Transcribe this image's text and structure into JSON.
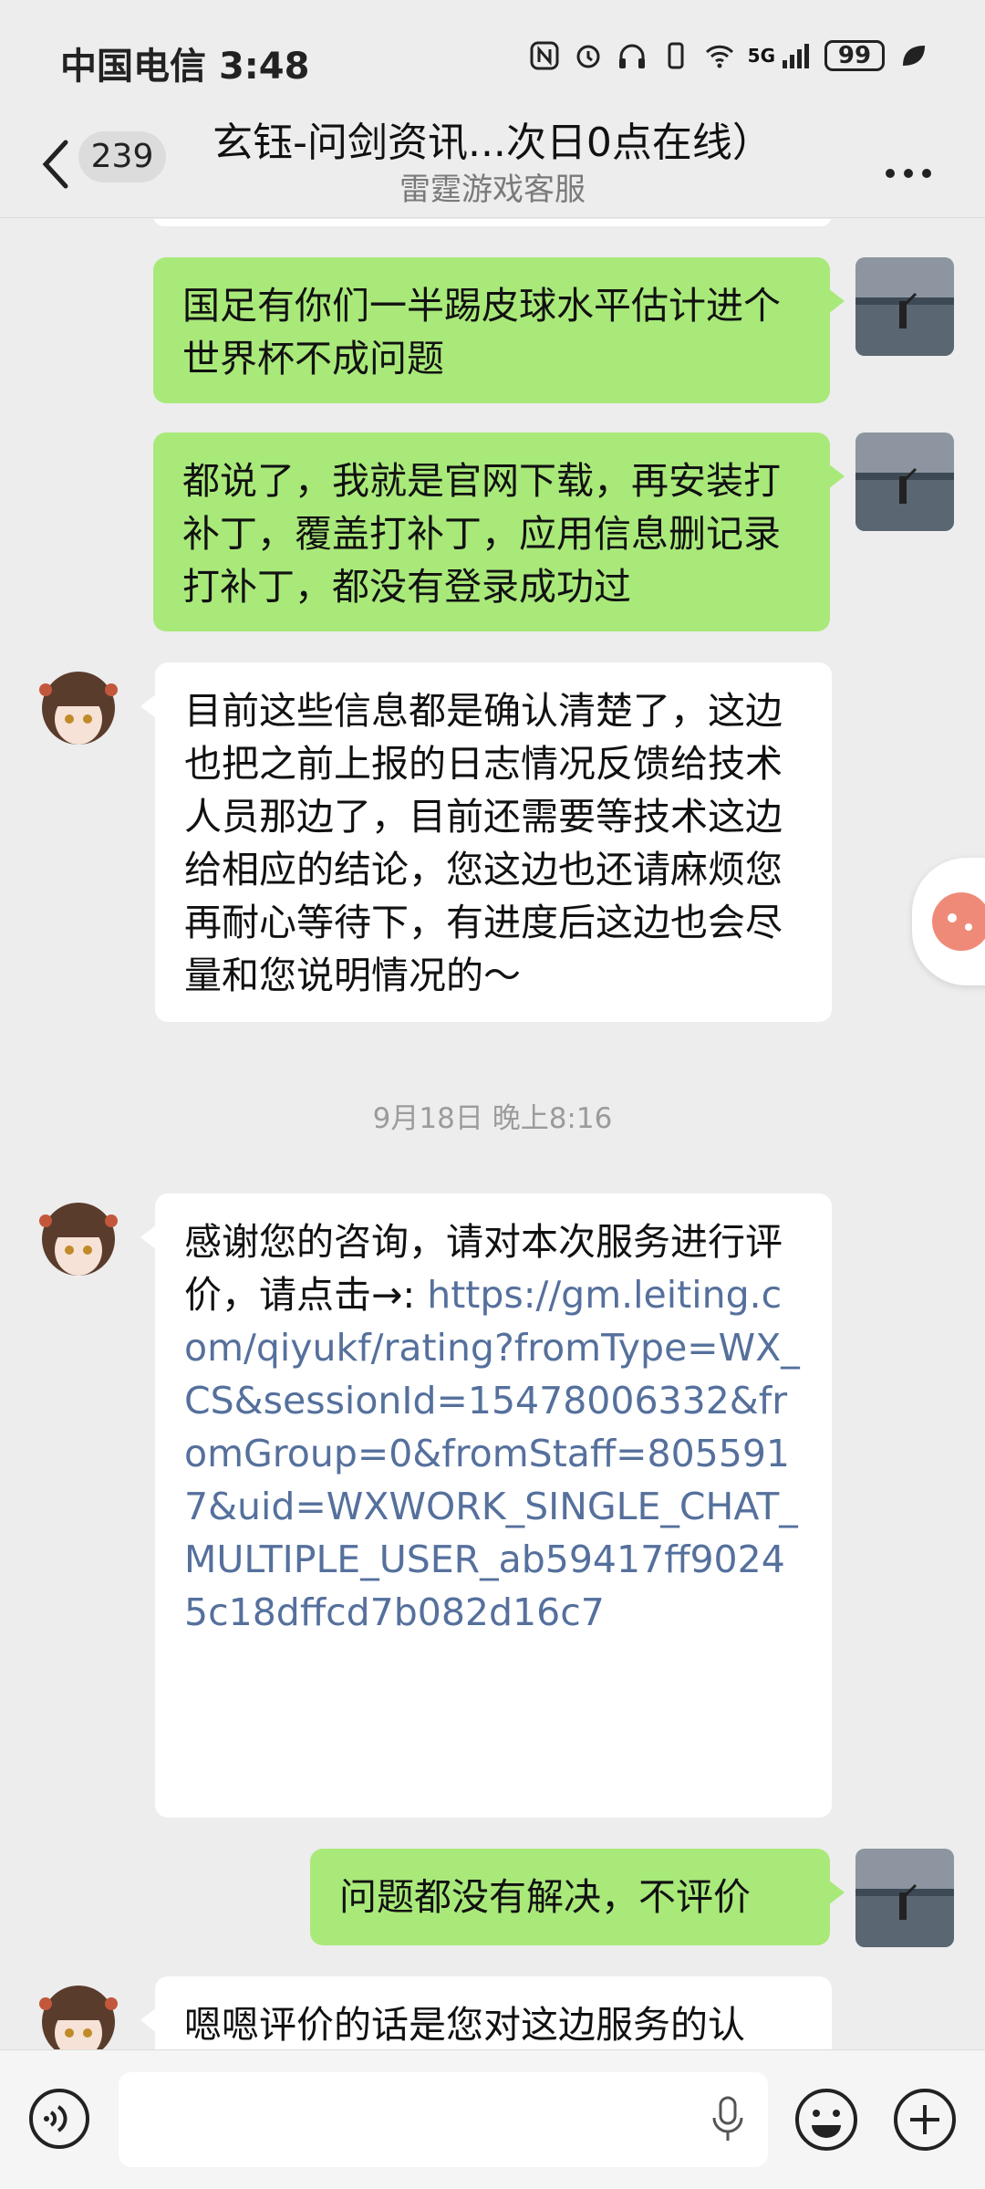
{
  "status_bar": {
    "carrier": "中国电信",
    "time": "3:48",
    "network": "5G",
    "battery": "99"
  },
  "header": {
    "back_count": "239",
    "title": "玄钰-问剑资讯...次日0点在线）",
    "subtitle": "雷霆游戏客服",
    "more_icon": "ellipsis-icon"
  },
  "messages": [
    {
      "direction": "out",
      "text": "国足有你们一半踢皮球水平估计进个世界杯不成问题"
    },
    {
      "direction": "out",
      "text": "都说了，我就是官网下载，再安装打补丁，覆盖打补丁，应用信息删记录打补丁，都没有登录成功过"
    },
    {
      "direction": "in",
      "text": "目前这些信息都是确认清楚了，这边也把之前上报的日志情况反馈给技术人员那边了，目前还需要等技术这边给相应的结论，您这边也还请麻烦您再耐心等待下，有进度后这边也会尽量和您说明情况的～"
    },
    {
      "direction": "in",
      "text_prefix": "感谢您的咨询，请对本次服务进行评价，请点击→: ",
      "link": "https://gm.leiting.com/qiyukf/rating?fromType=WX_CS&sessionId=15478006332&fromGroup=0&fromStaff=8055917&uid=WXWORK_SINGLE_CHAT_MULTIPLE_USER_ab59417ff90245c18dffcd7b082d16c7"
    },
    {
      "direction": "out",
      "text": "问题都没有解决，不评价"
    },
    {
      "direction": "in",
      "text": "嗯嗯评价的话是您对这边服务的认"
    }
  ],
  "timestamp": "9月18日 晚上8:16",
  "colors": {
    "outgoing_bubble": "#a9e97a",
    "incoming_bubble": "#ffffff",
    "background": "#ededed",
    "link": "#55709c"
  }
}
